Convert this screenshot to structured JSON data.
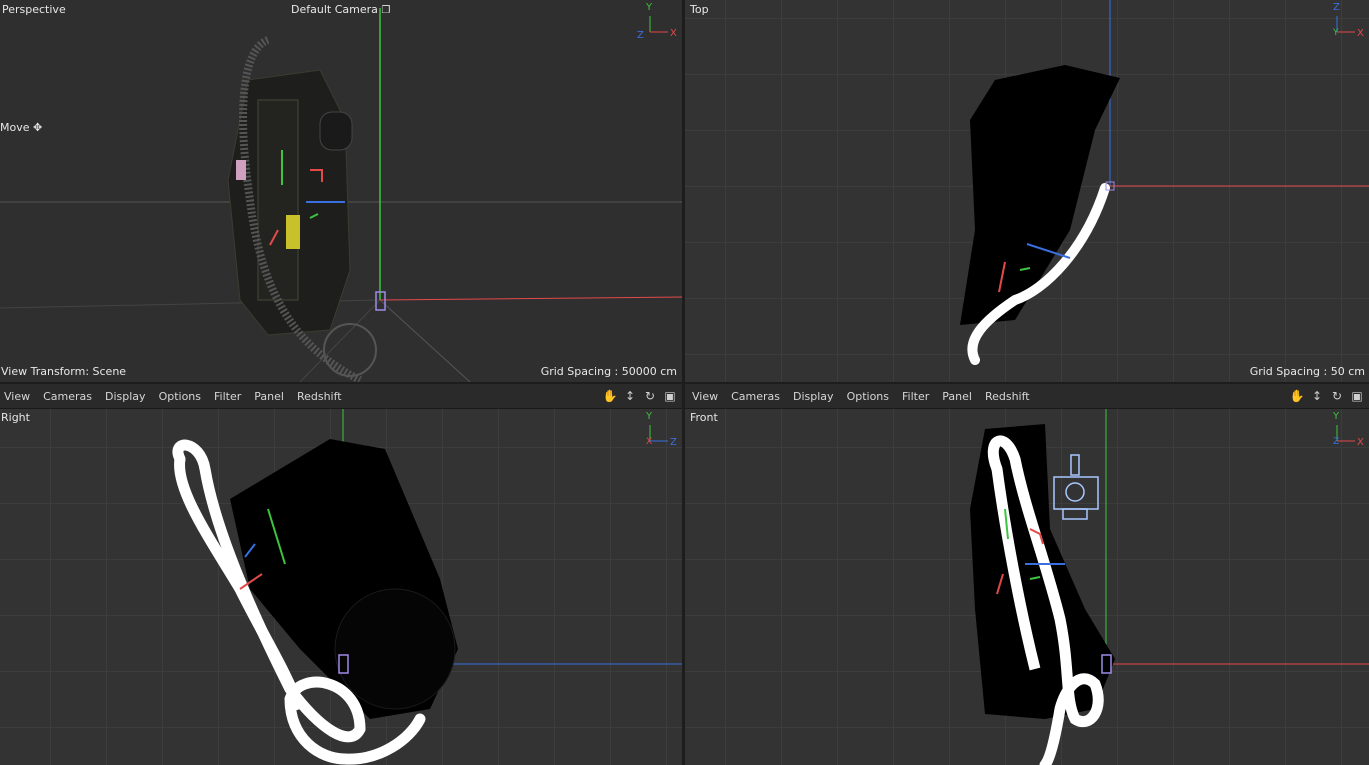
{
  "viewports": {
    "perspective": {
      "name": "Perspective",
      "camera": "Default Camera",
      "tool": "Move",
      "view_transform": "View Transform: Scene",
      "grid_spacing": "Grid Spacing : 50000 cm"
    },
    "top": {
      "name": "Top",
      "grid_spacing": "Grid Spacing : 50 cm"
    },
    "right": {
      "name": "Right"
    },
    "front": {
      "name": "Front"
    }
  },
  "axes": {
    "x": "X",
    "y": "Y",
    "z": "Z"
  },
  "menu": {
    "view": "View",
    "cameras": "Cameras",
    "display": "Display",
    "options": "Options",
    "filter": "Filter",
    "panel": "Panel",
    "redshift": "Redshift"
  },
  "icons": [
    "hand-pan-icon",
    "move-arrows-icon",
    "rotate-icon",
    "maximize-panel-icon",
    "camera-lock-icon",
    "move-tool-icon"
  ],
  "colors": {
    "x_axis": "#e24a4a",
    "y_axis": "#3ec43e",
    "z_axis": "#3a6fe0",
    "viewport_bg": "#333333",
    "grid_line": "#3d3d3d"
  }
}
